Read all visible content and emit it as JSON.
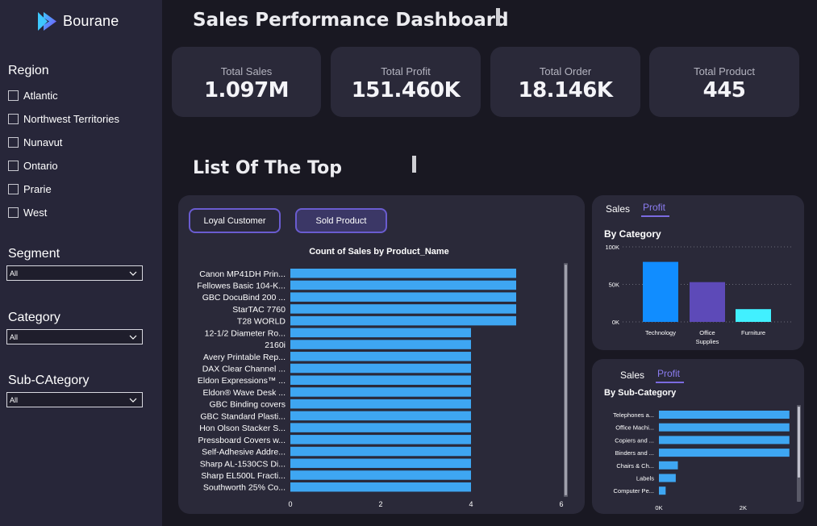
{
  "app": {
    "name": "Bourane"
  },
  "filters": {
    "region_title": "Region",
    "regions": [
      "Atlantic",
      "Northwest Territories",
      "Nunavut",
      "Ontario",
      "Prarie",
      "West"
    ],
    "segment_title": "Segment",
    "segment_value": "All",
    "category_title": "Category",
    "category_value": "All",
    "subcategory_title": "Sub-CAtegory",
    "subcategory_value": "All"
  },
  "header": {
    "title": "Sales Performance Dashboard"
  },
  "kpis": [
    {
      "label": "Total Sales",
      "value": "1.097M"
    },
    {
      "label": "Total Profit",
      "value": "151.460K"
    },
    {
      "label": "Total Order",
      "value": "18.146K"
    },
    {
      "label": "Total Product",
      "value": "445"
    }
  ],
  "list_section": {
    "title": "List Of The Top",
    "buttons": {
      "loyal_customer": "Loyal Customer",
      "sold_product": "Sold Product"
    },
    "chart_title": "Count of Sales by Product_Name"
  },
  "category_panel": {
    "tab_sales": "Sales",
    "tab_profit": "Profit",
    "chart_title": "By Category"
  },
  "subcategory_panel": {
    "tab_sales": "Sales",
    "tab_profit": "Profit",
    "chart_title": "By Sub-Category"
  },
  "colors": {
    "accent": "#7b6be0",
    "bar_blue": "#3ea6f2",
    "tech": "#118dff",
    "office": "#5d4ab8",
    "furniture": "#41f0ff"
  },
  "chart_data": [
    {
      "type": "bar",
      "orientation": "horizontal",
      "title": "Count of Sales by Product_Name",
      "categories": [
        "Canon MP41DH Prin...",
        "Fellowes Basic 104-K...",
        "GBC DocuBind 200 ...",
        "StarTAC 7760",
        "T28 WORLD",
        "12-1/2 Diameter Ro...",
        "2160i",
        "Avery Printable Rep...",
        "DAX Clear Channel ...",
        "Eldon Expressions™ ...",
        "Eldon® Wave Desk ...",
        "GBC Binding covers",
        "GBC Standard Plasti...",
        "Hon Olson Stacker S...",
        "Pressboard Covers w...",
        "Self-Adhesive Addre...",
        "Sharp AL-1530CS Di...",
        "Sharp EL500L Fracti...",
        "Southworth 25% Co..."
      ],
      "values": [
        5,
        5,
        5,
        5,
        5,
        4,
        4,
        4,
        4,
        4,
        4,
        4,
        4,
        4,
        4,
        4,
        4,
        4,
        4
      ],
      "xticks": [
        "0",
        "2",
        "4",
        "6"
      ],
      "xlim": [
        0,
        6
      ]
    },
    {
      "type": "bar",
      "title": "By Category",
      "categories": [
        "Technology",
        "Office Supplies",
        "Furniture"
      ],
      "category_lines": [
        [
          "Technology"
        ],
        [
          "Office",
          "Supplies"
        ],
        [
          "Furniture"
        ]
      ],
      "values": [
        80000,
        53000,
        17000
      ],
      "yticks": [
        "100K",
        "50K",
        "0K"
      ],
      "ylim": [
        0,
        100000
      ]
    },
    {
      "type": "bar",
      "orientation": "horizontal",
      "title": "By Sub-Category",
      "categories": [
        "Telephones a...",
        "Office Machi...",
        "Copiers and ...",
        "Binders and ...",
        "Chairs & Ch...",
        "Labels",
        "Computer Pe..."
      ],
      "values": [
        3100,
        3100,
        3100,
        3100,
        450,
        400,
        160
      ],
      "xticks": [
        "0K",
        "2K"
      ],
      "xlim": [
        0,
        3200
      ]
    }
  ]
}
